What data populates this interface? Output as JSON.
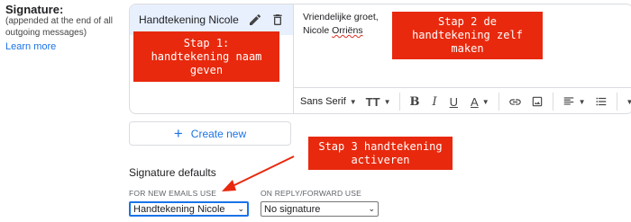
{
  "signature": {
    "title": "Signature:",
    "description": "(appended at the end of all outgoing messages)",
    "learn_more": "Learn more"
  },
  "signature_list": [
    {
      "name": "Handtekening Nicole"
    }
  ],
  "editor": {
    "line1": "Vriendelijke groet,",
    "line2_first": "Nicole ",
    "line2_last": "Orriëns"
  },
  "toolbar": {
    "font": "Sans Serif",
    "size_icon": "TT",
    "bold": "B",
    "italic": "I",
    "underline": "U",
    "text_color": "A"
  },
  "annotations": {
    "step1": "Stap 1:\nhandtekening naam\ngeven",
    "step2": "Stap 2 de\nhandtekening zelf\nmaken",
    "step3": "Stap 3 handtekening\nactiveren"
  },
  "create_new": "Create new",
  "defaults": {
    "title": "Signature defaults",
    "new_emails_label": "FOR NEW EMAILS USE",
    "reply_label": "ON REPLY/FORWARD USE",
    "new_emails_value": "Handtekening Nicole",
    "reply_value": "No signature"
  },
  "colors": {
    "annotation": "#e8290d",
    "accent": "#1a73e8",
    "selected_row": "#e8f0fe"
  }
}
